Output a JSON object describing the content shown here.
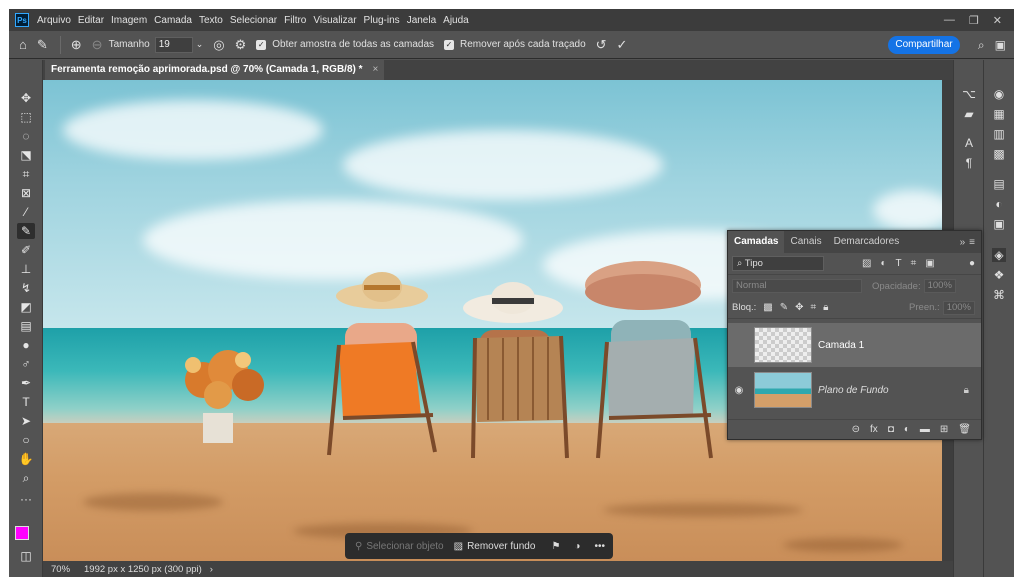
{
  "menubar": {
    "app_logo": "Ps",
    "items": [
      "Arquivo",
      "Editar",
      "Imagem",
      "Camada",
      "Texto",
      "Selecionar",
      "Filtro",
      "Visualizar",
      "Plug-ins",
      "Janela",
      "Ajuda"
    ]
  },
  "options_bar": {
    "size_label": "Tamanho",
    "size_value": "19",
    "sample_all_layers_label": "Obter amostra de todas as camadas",
    "remove_after_stroke_label": "Remover após cada traçado",
    "share_label": "Compartilhar"
  },
  "document": {
    "tab_title": "Ferramenta remoção aprimorada.psd @ 70% (Camada 1, RGB/8) *",
    "close_glyph": "×"
  },
  "context_bar": {
    "select_object_label": "Selecionar objeto",
    "remove_background_label": "Remover fundo",
    "more_glyph": "•••"
  },
  "status_bar": {
    "zoom": "70%",
    "doc_info": "1992 px x 1250 px (300 ppi)"
  },
  "layers_panel": {
    "tabs": [
      "Camadas",
      "Canais",
      "Demarcadores"
    ],
    "filter_label": "Tipo",
    "blend_mode": "Normal",
    "opacity_label": "Opacidade:",
    "opacity_value": "100%",
    "lock_label": "Bloq.:",
    "fill_label": "Preen.:",
    "fill_value": "100%",
    "layers": [
      {
        "name": "Camada 1",
        "visible": false,
        "selected": true
      },
      {
        "name": "Plano de Fundo",
        "visible": true,
        "selected": false,
        "locked": true
      }
    ]
  },
  "colors": {
    "foreground": "#ff00ff",
    "background": "#ffffff",
    "accent": "#1473e6"
  }
}
